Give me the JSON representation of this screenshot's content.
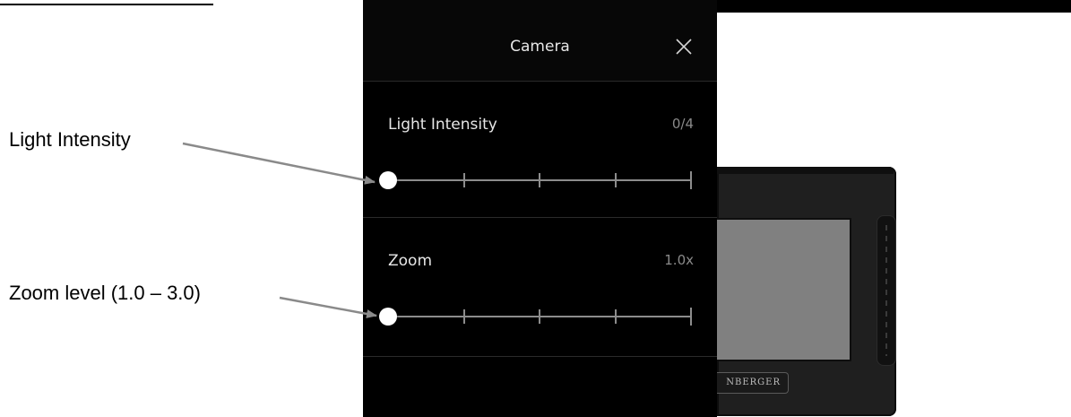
{
  "annotations": {
    "light_intensity": "Light Intensity",
    "zoom_level": "Zoom level (1.0 – 3.0)"
  },
  "panel": {
    "title": "Camera",
    "close_icon": "close-icon",
    "light": {
      "label": "Light Intensity",
      "value": "0/4",
      "level": 0,
      "max": 4,
      "ticks": 5
    },
    "zoom": {
      "label": "Zoom",
      "value": "1.0x",
      "level": 1.0,
      "min": 1.0,
      "max": 3.0,
      "ticks": 5
    }
  },
  "device": {
    "brand_text": "NBERGER"
  },
  "colors": {
    "panel_bg": "#000000",
    "text": "#e6e6e6",
    "value_text": "#8a8a8a",
    "track": "#8c8c8c",
    "thumb": "#ffffff",
    "device_screen": "#808080"
  }
}
